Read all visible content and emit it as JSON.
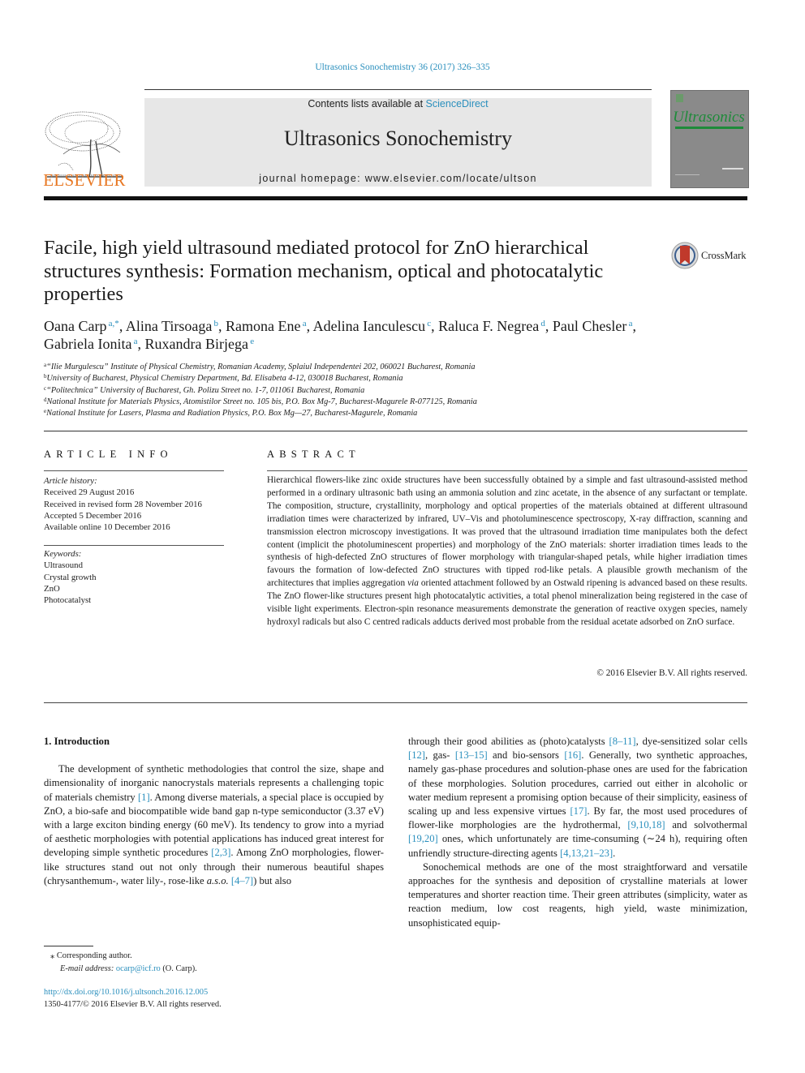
{
  "header": {
    "citation": "Ultrasonics Sonochemistry 36 (2017) 326–335",
    "publisher_logo_text": "ELSEVIER",
    "contents_prefix": "Contents lists available at ",
    "contents_link": "ScienceDirect",
    "journal_name": "Ultrasonics Sonochemistry",
    "homepage_prefix": "journal homepage: ",
    "homepage_url": "www.elsevier.com/locate/ultson",
    "cover_title": "Ultrasonics"
  },
  "article": {
    "title": "Facile, high yield ultrasound mediated protocol for ZnO hierarchical structures synthesis: Formation mechanism, optical and photocatalytic properties",
    "crossmark_label": "CrossMark",
    "authors": [
      {
        "name": "Oana Carp",
        "sup": "a,*"
      },
      {
        "name": "Alina Tirsoaga",
        "sup": "b"
      },
      {
        "name": "Ramona Ene",
        "sup": "a"
      },
      {
        "name": "Adelina Ianculescu",
        "sup": "c"
      },
      {
        "name": "Raluca F. Negrea",
        "sup": "d"
      },
      {
        "name": "Paul Chesler",
        "sup": "a"
      },
      {
        "name": "Gabriela Ionita",
        "sup": "a"
      },
      {
        "name": "Ruxandra Birjega",
        "sup": "e"
      }
    ],
    "affiliations": [
      {
        "key": "a",
        "text": "“Ilie Murgulescu” Institute of Physical Chemistry, Romanian Academy, Splaiul Independentei 202, 060021 Bucharest, Romania"
      },
      {
        "key": "b",
        "text": "University of Bucharest, Physical Chemistry Department, Bd. Elisabeta 4-12, 030018 Bucharest, Romania"
      },
      {
        "key": "c",
        "text": "“Politechnica” University of Bucharest, Gh. Polizu Street no. 1-7, 011061 Bucharest, Romania"
      },
      {
        "key": "d",
        "text": "National Institute for Materials Physics, Atomistilor Street no. 105 bis, P.O. Box Mg-7, Bucharest-Magurele R-077125, Romania"
      },
      {
        "key": "e",
        "text": "National Institute for Lasers, Plasma and Radiation Physics, P.O. Box Mg—27, Bucharest-Magurele, Romania"
      }
    ]
  },
  "article_info": {
    "heading": "ARTICLE INFO",
    "history_label": "Article history:",
    "history": [
      "Received 29 August 2016",
      "Received in revised form 28 November 2016",
      "Accepted 5 December 2016",
      "Available online 10 December 2016"
    ],
    "keywords_label": "Keywords:",
    "keywords": [
      "Ultrasound",
      "Crystal growth",
      "ZnO",
      "Photocatalyst"
    ]
  },
  "abstract": {
    "heading": "ABSTRACT",
    "part1": "Hierarchical flowers-like zinc oxide structures have been successfully obtained by a simple and fast ultrasound-assisted method performed in a ordinary ultrasonic bath using an ammonia solution and zinc acetate, in the absence of any surfactant or template. The composition, structure, crystallinity, morphology and optical properties of the materials obtained at different ultrasound irradiation times were characterized by infrared, UV–Vis and photoluminescence spectroscopy, X-ray diffraction, scanning and transmission electron microscopy investigations. It was proved that the ultrasound irradiation time manipulates both the defect content (implicit the photoluminescent properties) and morphology of the ZnO materials: shorter irradiation times leads to the synthesis of high-defected ZnO structures of flower morphology with triangular-shaped petals, while higher irradiation times favours the formation of low-defected ZnO structures with tipped rod-like petals. A plausible growth mechanism of the architectures that implies aggregation ",
    "italic": "via",
    "part2": " oriented attachment followed by an Ostwald ripening is advanced based on these results. The ZnO flower-like structures present high photocatalytic activities, a total phenol mineralization being registered in the case of visible light experiments. Electron-spin resonance measurements demonstrate the generation of reactive oxygen species, namely hydroxyl radicals but also C centred radicals adducts derived most probable from the residual acetate adsorbed on ZnO surface.",
    "copyright": "© 2016 Elsevier B.V. All rights reserved."
  },
  "body": {
    "section_heading": "1. Introduction",
    "left_p1": [
      {
        "t": "The development of synthetic methodologies that control the size, shape and dimensionality of inorganic nanocrystals materials represents a challenging topic of materials chemistry "
      },
      {
        "ref": "[1]"
      },
      {
        "t": ". Among diverse materials, a special place is occupied by ZnO, a bio-safe and biocompatible wide band gap n-type semiconductor (3.37 eV) with a large exciton binding energy (60 meV). Its tendency to grow into a myriad of aesthetic morphologies with potential applications has induced great interest for developing simple synthetic procedures "
      },
      {
        "ref": "[2,3]"
      },
      {
        "t": ". Among ZnO morphologies, flower-like structures stand out not only through their numerous beautiful shapes (chrysanthemum-, water lily-, rose-like "
      },
      {
        "i": "a.s.o."
      },
      {
        "t": " "
      },
      {
        "ref": "[4–7]"
      },
      {
        "t": ") but also"
      }
    ],
    "right_p1": [
      {
        "t": "through their good abilities as (photo)catalysts "
      },
      {
        "ref": "[8–11]"
      },
      {
        "t": ", dye-sensitized solar cells "
      },
      {
        "ref": "[12]"
      },
      {
        "t": ", gas- "
      },
      {
        "ref": "[13–15]"
      },
      {
        "t": " and bio-sensors "
      },
      {
        "ref": "[16]"
      },
      {
        "t": ". Generally, two synthetic approaches, namely gas-phase procedures and solution-phase ones are used for the fabrication of these morphologies. Solution procedures, carried out either in alcoholic or water medium represent a promising option because of their simplicity, easiness of scaling up and less expensive virtues "
      },
      {
        "ref": "[17]"
      },
      {
        "t": ". By far, the most used procedures of flower-like morphologies are the hydrothermal, "
      },
      {
        "ref": "[9,10,18]"
      },
      {
        "t": " and solvothermal "
      },
      {
        "ref": "[19,20]"
      },
      {
        "t": " ones, which unfortunately are time-consuming (∼24 h), requiring often unfriendly structure-directing agents "
      },
      {
        "ref": "[4,13,21–23]"
      },
      {
        "t": "."
      }
    ],
    "right_p2": "Sonochemical methods are one of the most straightforward and versatile approaches for the synthesis and deposition of crystalline materials at lower temperatures and shorter reaction time. Their green attributes (simplicity, water as reaction medium, low cost reagents, high yield, waste minimization, unsophisticated equip-"
  },
  "footnote": {
    "marker": "⁎",
    "corresponding": "Corresponding author.",
    "email_label": "E-mail address:",
    "email": "ocarp@icf.ro",
    "email_suffix": " (O. Carp).",
    "doi": "http://dx.doi.org/10.1016/j.ultsonch.2016.12.005",
    "issn": "1350-4177/© 2016 Elsevier B.V. All rights reserved."
  },
  "colors": {
    "link": "#2a8fbd",
    "elsevier_orange": "#e87722",
    "masthead_bg": "#e7e7e7",
    "cover_gray": "#8a8a8a",
    "cover_green": "#1e8b3a",
    "crossmark_red": "#c0392b"
  }
}
